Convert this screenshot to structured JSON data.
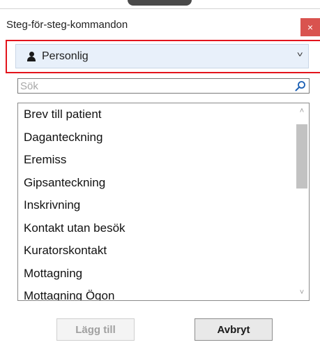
{
  "window": {
    "title": "Steg-för-steg-kommandon",
    "close_label": "×"
  },
  "dropdown": {
    "icon": "person-icon",
    "selected": "Personlig",
    "chevron": "˅"
  },
  "search": {
    "value": "",
    "placeholder": "Sök",
    "icon": "magnifier-icon"
  },
  "list": {
    "items": [
      "Brev till patient",
      "Daganteckning",
      "Eremiss",
      "Gipsanteckning",
      "Inskrivning",
      "Kontakt utan besök",
      "Kuratorskontakt",
      "Mottagning",
      "Mottagning Ögon"
    ],
    "scroll_up": "˄",
    "scroll_down": "˅"
  },
  "buttons": {
    "add_label": "Lägg till",
    "cancel_label": "Avbryt"
  },
  "colors": {
    "close": "#d9534f",
    "highlight": "#e3141c",
    "dropdown_bg": "#e8f0fa",
    "search_icon": "#1a5fb4"
  }
}
